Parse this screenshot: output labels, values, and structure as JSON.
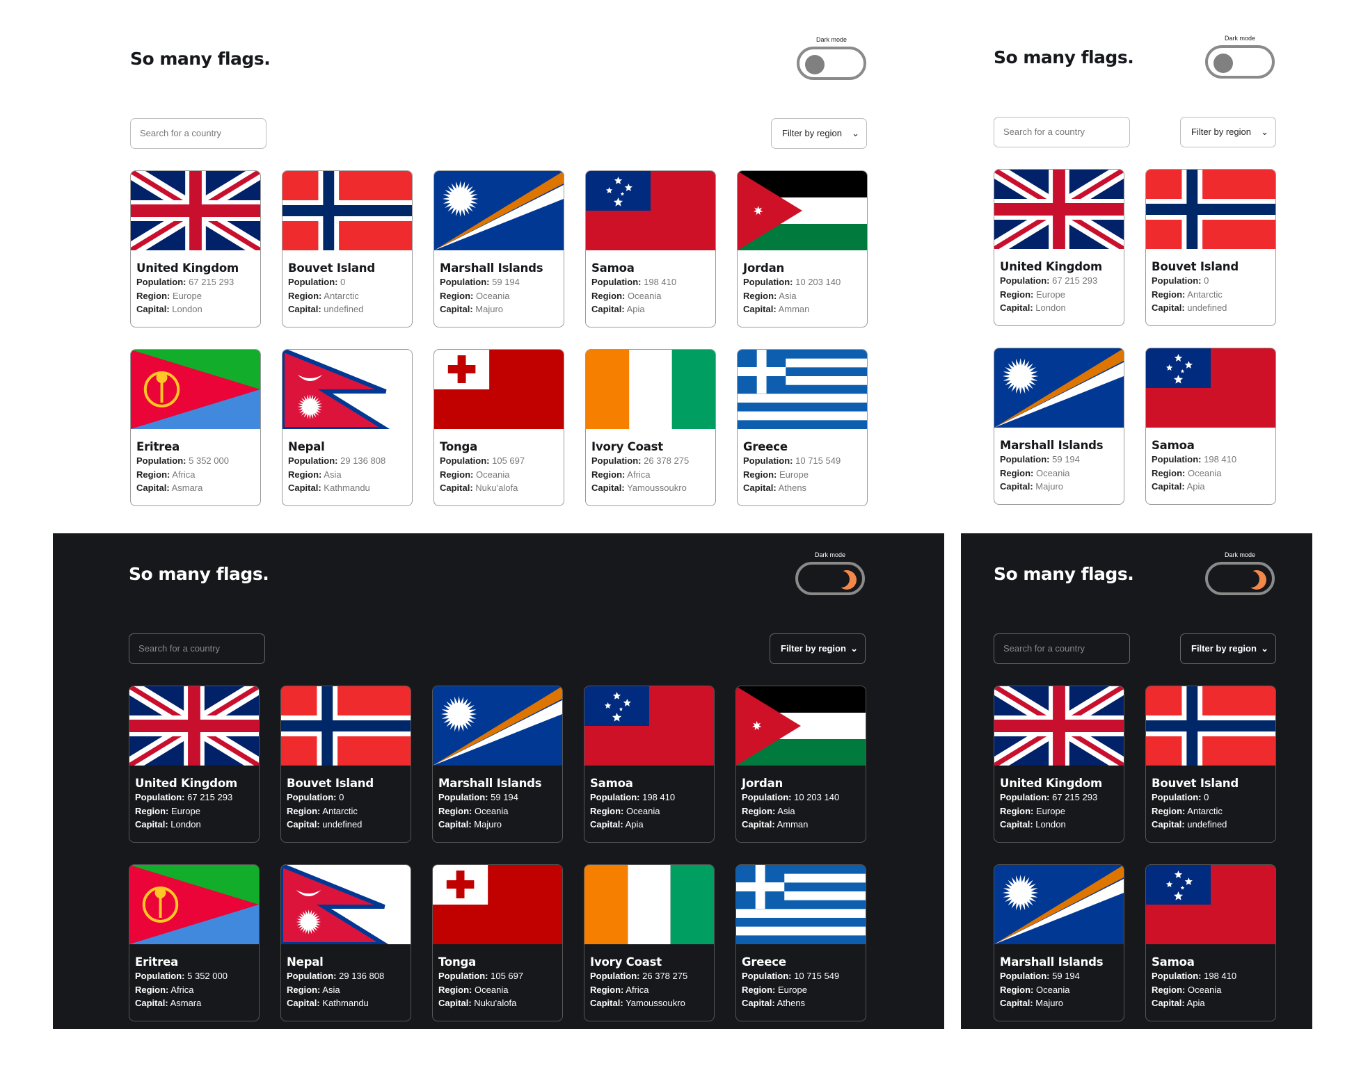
{
  "app": {
    "title": "So many flags.",
    "dark_mode_label": "Dark mode",
    "search_placeholder": "Search for a country",
    "filter_label": "Filter by region",
    "filter_chevron": "⌄"
  },
  "labels": {
    "population": "Population:",
    "region": "Region:",
    "capital": "Capital:"
  },
  "countries": [
    {
      "name": "United Kingdom",
      "population": "67 215 293",
      "region": "Europe",
      "capital": "London",
      "flag": "uk-flag-icon"
    },
    {
      "name": "Bouvet Island",
      "population": "0",
      "region": "Antarctic",
      "capital": "undefined",
      "flag": "norway-flag-icon"
    },
    {
      "name": "Marshall Islands",
      "population": "59 194",
      "region": "Oceania",
      "capital": "Majuro",
      "flag": "marshall-flag-icon"
    },
    {
      "name": "Samoa",
      "population": "198 410",
      "region": "Oceania",
      "capital": "Apia",
      "flag": "samoa-flag-icon"
    },
    {
      "name": "Jordan",
      "population": "10 203 140",
      "region": "Asia",
      "capital": "Amman",
      "flag": "jordan-flag-icon"
    },
    {
      "name": "Eritrea",
      "population": "5 352 000",
      "region": "Africa",
      "capital": "Asmara",
      "flag": "eritrea-flag-icon"
    },
    {
      "name": "Nepal",
      "population": "29 136 808",
      "region": "Asia",
      "capital": "Kathmandu",
      "flag": "nepal-flag-icon"
    },
    {
      "name": "Tonga",
      "population": "105 697",
      "region": "Oceania",
      "capital": "Nuku'alofa",
      "flag": "tonga-flag-icon"
    },
    {
      "name": "Ivory Coast",
      "population": "26 378 275",
      "region": "Africa",
      "capital": "Yamoussoukro",
      "flag": "ivory-coast-flag-icon"
    },
    {
      "name": "Greece",
      "population": "10 715 549",
      "region": "Europe",
      "capital": "Athens",
      "flag": "greece-flag-icon"
    }
  ],
  "themes": {
    "light": {
      "background": "#ffffff",
      "text": "#16181b"
    },
    "dark": {
      "background": "#16181b",
      "text": "#ffffff",
      "accent": "#f4874a"
    }
  }
}
